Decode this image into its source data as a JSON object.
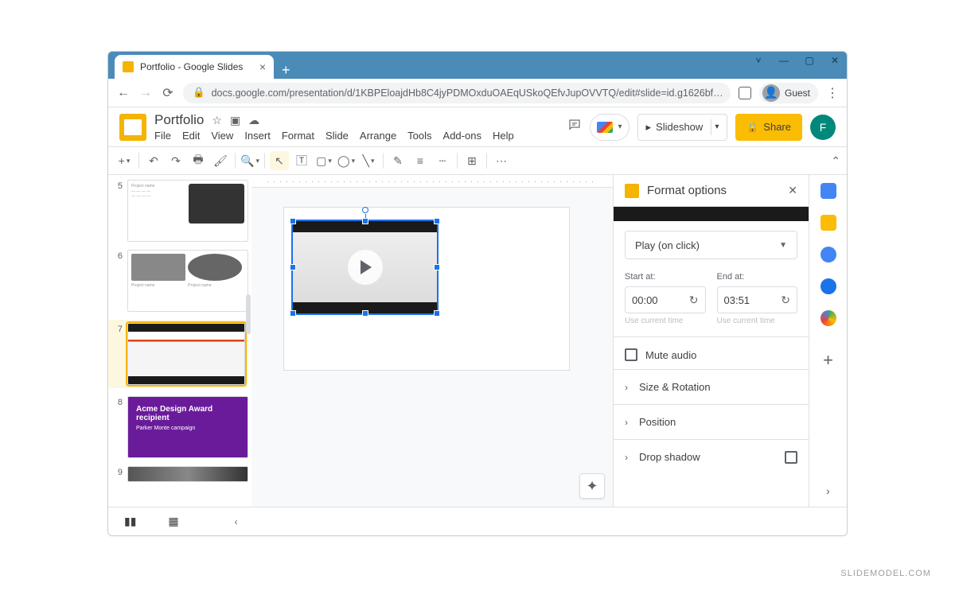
{
  "browser": {
    "tab_title": "Portfolio - Google Slides",
    "url": "docs.google.com/presentation/d/1KBPEloajdHb8C4jyPDMOxduOAEqUSkoQEfvJupOVVTQ/edit#slide=id.g1626bf…",
    "guest_label": "Guest"
  },
  "app": {
    "title": "Portfolio",
    "menus": [
      "File",
      "Edit",
      "View",
      "Insert",
      "Format",
      "Slide",
      "Arrange",
      "Tools",
      "Add-ons",
      "Help"
    ],
    "slideshow_label": "Slideshow",
    "share_label": "Share",
    "avatar_letter": "F"
  },
  "thumbnails": [
    {
      "num": "5"
    },
    {
      "num": "6"
    },
    {
      "num": "7",
      "active": true
    },
    {
      "num": "8",
      "title": "Acme Design Award recipient",
      "subtitle": "Parker Monte campaign"
    },
    {
      "num": "9"
    }
  ],
  "format_panel": {
    "title": "Format options",
    "play_mode": "Play (on click)",
    "start_label": "Start at:",
    "end_label": "End at:",
    "start_value": "00:00",
    "end_value": "03:51",
    "use_current_time": "Use current time",
    "mute_label": "Mute audio",
    "sections": [
      "Size & Rotation",
      "Position",
      "Drop shadow"
    ]
  },
  "watermark": "SLIDEMODEL.COM"
}
